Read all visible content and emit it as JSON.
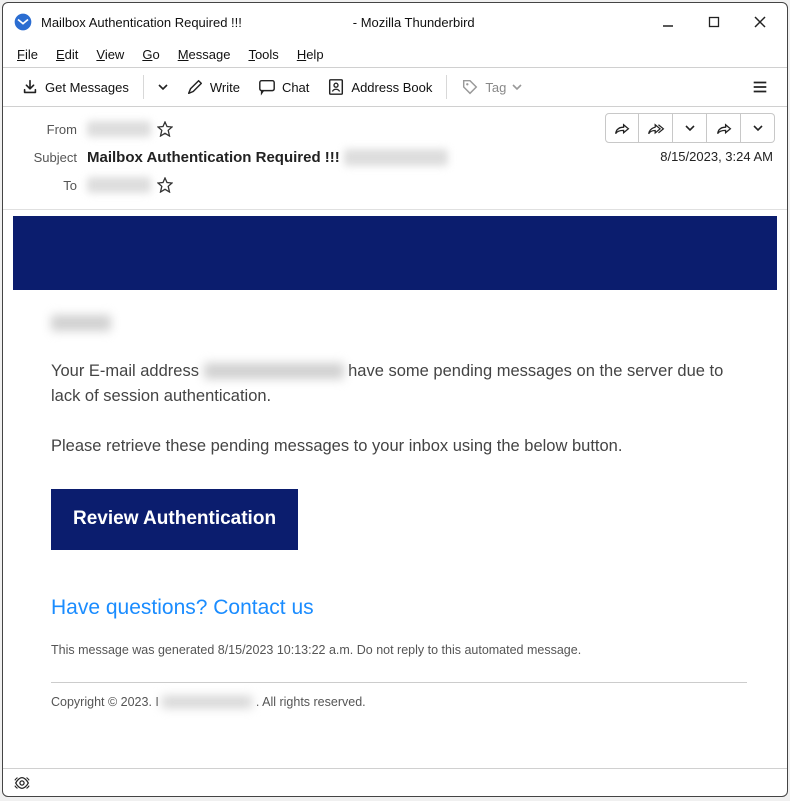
{
  "window": {
    "title_prefix": "Mailbox Authentication Required !!!",
    "title_suffix": " - Mozilla Thunderbird"
  },
  "menubar": {
    "file": "File",
    "edit": "Edit",
    "view": "View",
    "go": "Go",
    "message": "Message",
    "tools": "Tools",
    "help": "Help"
  },
  "toolbar": {
    "get_messages": "Get Messages",
    "write": "Write",
    "chat": "Chat",
    "address_book": "Address Book",
    "tag": "Tag"
  },
  "headers": {
    "from_label": "From",
    "subject_label": "Subject",
    "to_label": "To",
    "subject_value": "Mailbox Authentication Required !!!",
    "date": "8/15/2023, 3:24 AM"
  },
  "body": {
    "p1a": "Your E-mail  address ",
    "p1b": " have some pending messages on the server due to lack of session authentication.",
    "p2": "Please retrieve these pending messages to your inbox using the below button.",
    "cta": "Review Authentication",
    "questions": "Have questions? Contact us",
    "generated": "This message was generated 8/15/2023 10:13:22 a.m. Do not reply to this automated message.",
    "copyright_a": "Copyright © 2023. I",
    "copyright_b": " .  All rights reserved."
  },
  "icons": {
    "app": "thunderbird-icon",
    "download": "download-icon",
    "write": "pencil-icon",
    "chat": "chat-icon",
    "book": "address-book-icon",
    "tag": "tag-icon",
    "menu": "menu-icon",
    "star": "star-icon",
    "reply": "reply-icon",
    "reply_all": "reply-all-icon",
    "forward": "forward-icon",
    "minimize": "minimize-icon",
    "maximize": "maximize-icon",
    "close": "close-icon",
    "chevron": "chevron-down-icon",
    "remote": "remote-content-icon"
  }
}
